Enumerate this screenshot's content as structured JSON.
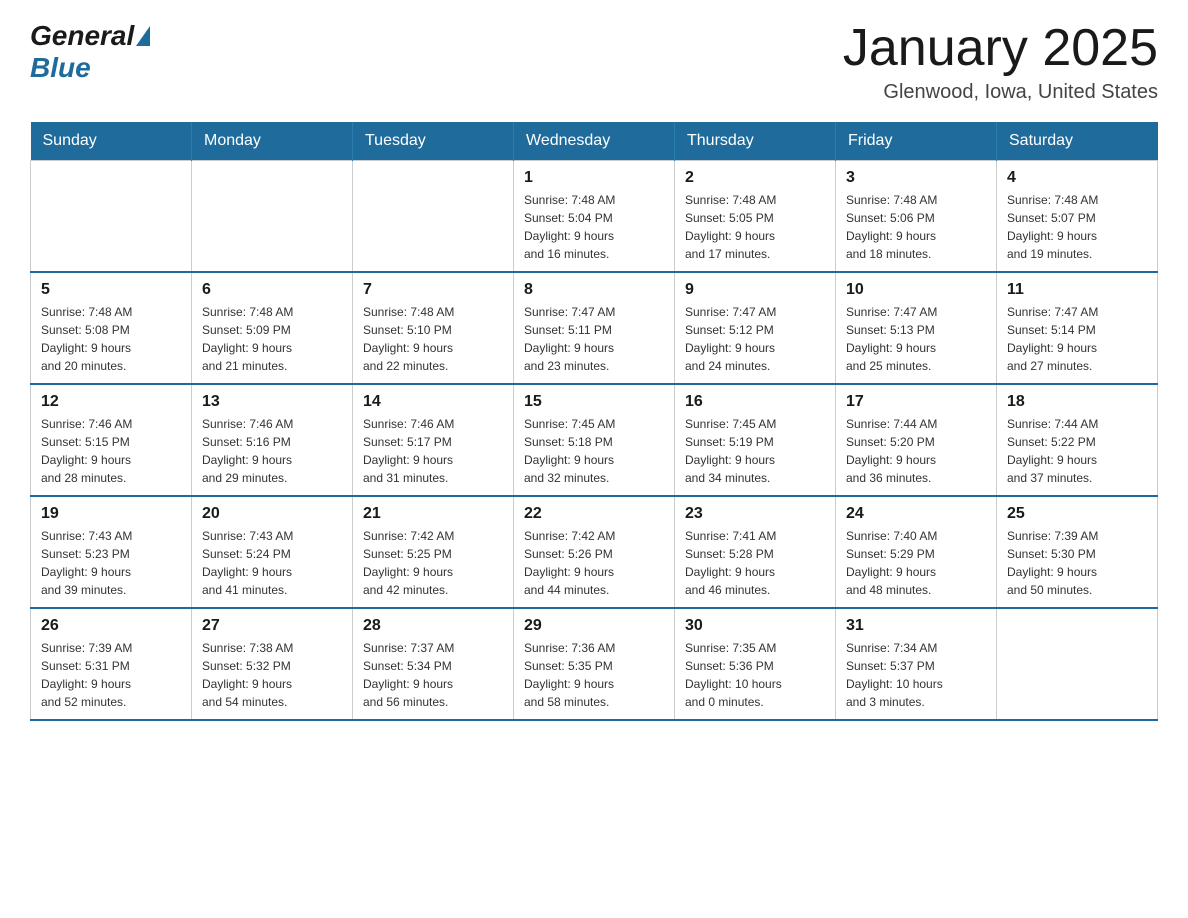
{
  "logo": {
    "general_text": "General",
    "blue_text": "Blue"
  },
  "title": "January 2025",
  "location": "Glenwood, Iowa, United States",
  "days_of_week": [
    "Sunday",
    "Monday",
    "Tuesday",
    "Wednesday",
    "Thursday",
    "Friday",
    "Saturday"
  ],
  "weeks": [
    [
      {
        "day": "",
        "info": ""
      },
      {
        "day": "",
        "info": ""
      },
      {
        "day": "",
        "info": ""
      },
      {
        "day": "1",
        "info": "Sunrise: 7:48 AM\nSunset: 5:04 PM\nDaylight: 9 hours\nand 16 minutes."
      },
      {
        "day": "2",
        "info": "Sunrise: 7:48 AM\nSunset: 5:05 PM\nDaylight: 9 hours\nand 17 minutes."
      },
      {
        "day": "3",
        "info": "Sunrise: 7:48 AM\nSunset: 5:06 PM\nDaylight: 9 hours\nand 18 minutes."
      },
      {
        "day": "4",
        "info": "Sunrise: 7:48 AM\nSunset: 5:07 PM\nDaylight: 9 hours\nand 19 minutes."
      }
    ],
    [
      {
        "day": "5",
        "info": "Sunrise: 7:48 AM\nSunset: 5:08 PM\nDaylight: 9 hours\nand 20 minutes."
      },
      {
        "day": "6",
        "info": "Sunrise: 7:48 AM\nSunset: 5:09 PM\nDaylight: 9 hours\nand 21 minutes."
      },
      {
        "day": "7",
        "info": "Sunrise: 7:48 AM\nSunset: 5:10 PM\nDaylight: 9 hours\nand 22 minutes."
      },
      {
        "day": "8",
        "info": "Sunrise: 7:47 AM\nSunset: 5:11 PM\nDaylight: 9 hours\nand 23 minutes."
      },
      {
        "day": "9",
        "info": "Sunrise: 7:47 AM\nSunset: 5:12 PM\nDaylight: 9 hours\nand 24 minutes."
      },
      {
        "day": "10",
        "info": "Sunrise: 7:47 AM\nSunset: 5:13 PM\nDaylight: 9 hours\nand 25 minutes."
      },
      {
        "day": "11",
        "info": "Sunrise: 7:47 AM\nSunset: 5:14 PM\nDaylight: 9 hours\nand 27 minutes."
      }
    ],
    [
      {
        "day": "12",
        "info": "Sunrise: 7:46 AM\nSunset: 5:15 PM\nDaylight: 9 hours\nand 28 minutes."
      },
      {
        "day": "13",
        "info": "Sunrise: 7:46 AM\nSunset: 5:16 PM\nDaylight: 9 hours\nand 29 minutes."
      },
      {
        "day": "14",
        "info": "Sunrise: 7:46 AM\nSunset: 5:17 PM\nDaylight: 9 hours\nand 31 minutes."
      },
      {
        "day": "15",
        "info": "Sunrise: 7:45 AM\nSunset: 5:18 PM\nDaylight: 9 hours\nand 32 minutes."
      },
      {
        "day": "16",
        "info": "Sunrise: 7:45 AM\nSunset: 5:19 PM\nDaylight: 9 hours\nand 34 minutes."
      },
      {
        "day": "17",
        "info": "Sunrise: 7:44 AM\nSunset: 5:20 PM\nDaylight: 9 hours\nand 36 minutes."
      },
      {
        "day": "18",
        "info": "Sunrise: 7:44 AM\nSunset: 5:22 PM\nDaylight: 9 hours\nand 37 minutes."
      }
    ],
    [
      {
        "day": "19",
        "info": "Sunrise: 7:43 AM\nSunset: 5:23 PM\nDaylight: 9 hours\nand 39 minutes."
      },
      {
        "day": "20",
        "info": "Sunrise: 7:43 AM\nSunset: 5:24 PM\nDaylight: 9 hours\nand 41 minutes."
      },
      {
        "day": "21",
        "info": "Sunrise: 7:42 AM\nSunset: 5:25 PM\nDaylight: 9 hours\nand 42 minutes."
      },
      {
        "day": "22",
        "info": "Sunrise: 7:42 AM\nSunset: 5:26 PM\nDaylight: 9 hours\nand 44 minutes."
      },
      {
        "day": "23",
        "info": "Sunrise: 7:41 AM\nSunset: 5:28 PM\nDaylight: 9 hours\nand 46 minutes."
      },
      {
        "day": "24",
        "info": "Sunrise: 7:40 AM\nSunset: 5:29 PM\nDaylight: 9 hours\nand 48 minutes."
      },
      {
        "day": "25",
        "info": "Sunrise: 7:39 AM\nSunset: 5:30 PM\nDaylight: 9 hours\nand 50 minutes."
      }
    ],
    [
      {
        "day": "26",
        "info": "Sunrise: 7:39 AM\nSunset: 5:31 PM\nDaylight: 9 hours\nand 52 minutes."
      },
      {
        "day": "27",
        "info": "Sunrise: 7:38 AM\nSunset: 5:32 PM\nDaylight: 9 hours\nand 54 minutes."
      },
      {
        "day": "28",
        "info": "Sunrise: 7:37 AM\nSunset: 5:34 PM\nDaylight: 9 hours\nand 56 minutes."
      },
      {
        "day": "29",
        "info": "Sunrise: 7:36 AM\nSunset: 5:35 PM\nDaylight: 9 hours\nand 58 minutes."
      },
      {
        "day": "30",
        "info": "Sunrise: 7:35 AM\nSunset: 5:36 PM\nDaylight: 10 hours\nand 0 minutes."
      },
      {
        "day": "31",
        "info": "Sunrise: 7:34 AM\nSunset: 5:37 PM\nDaylight: 10 hours\nand 3 minutes."
      },
      {
        "day": "",
        "info": ""
      }
    ]
  ]
}
